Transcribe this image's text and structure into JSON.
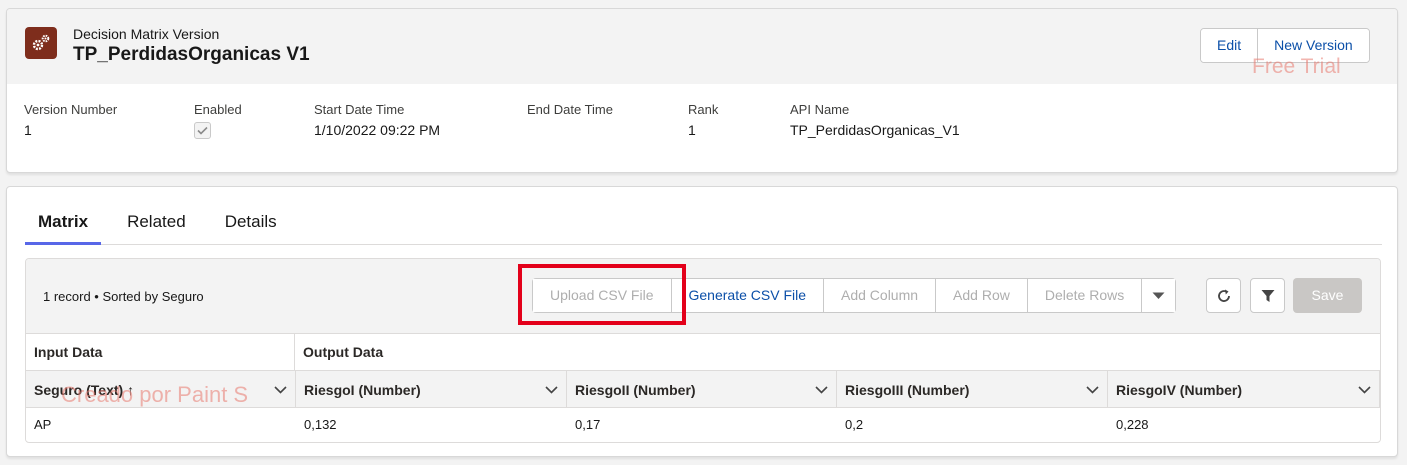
{
  "header": {
    "object_type": "Decision Matrix Version",
    "title": "TP_PerdidasOrganicas V1",
    "icon": "gears-icon",
    "actions": [
      "Edit",
      "New Version"
    ],
    "watermark": "Free Trial"
  },
  "fields": {
    "version_number": {
      "label": "Version Number",
      "value": "1"
    },
    "enabled": {
      "label": "Enabled",
      "checked": true
    },
    "start_date": {
      "label": "Start Date Time",
      "value": "1/10/2022 09:22 PM"
    },
    "end_date": {
      "label": "End Date Time",
      "value": ""
    },
    "rank": {
      "label": "Rank",
      "value": "1"
    },
    "api_name": {
      "label": "API Name",
      "value": "TP_PerdidasOrganicas_V1"
    }
  },
  "tabs": [
    "Matrix",
    "Related",
    "Details"
  ],
  "toolbar": {
    "record_info": "1 record • Sorted by Seguro",
    "buttons": [
      "Upload CSV File",
      "Generate CSV File",
      "Add Column",
      "Add Row",
      "Delete Rows"
    ],
    "save_label": "Save",
    "refresh_icon": "refresh-icon",
    "filter_icon": "filter-icon"
  },
  "table": {
    "groups": {
      "input": "Input Data",
      "output": "Output Data"
    },
    "columns": [
      "Seguro (Text) ↑",
      "RiesgoI (Number)",
      "RiesgoII (Number)",
      "RiesgoIII (Number)",
      "RiesgoIV (Number)"
    ],
    "rows": [
      [
        "AP",
        "0,132",
        "0,17",
        "0,2",
        "0,228"
      ]
    ],
    "watermark": "Creado por Paint S"
  },
  "colors": {
    "highlight": "#e3001a",
    "brand_link": "#0b4fa8",
    "tab_active": "#5867e8",
    "icon_bg": "#7e2d1c"
  }
}
